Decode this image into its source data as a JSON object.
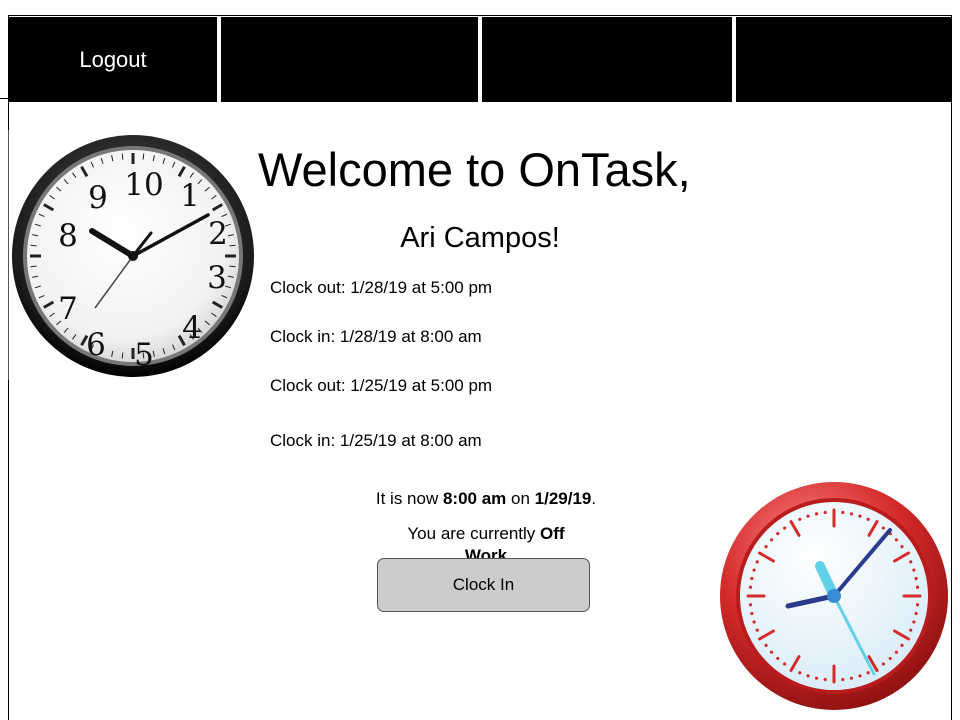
{
  "nav": {
    "logout_label": "Logout",
    "tab2_label": "",
    "tab3_label": "",
    "tab4_label": ""
  },
  "welcome": {
    "title": "Welcome to OnTask,",
    "user": "Ari Campos!"
  },
  "log": [
    "Clock out: 1/28/19 at 5:00 pm",
    "Clock in: 1/28/19 at 8:00 am",
    "Clock out: 1/25/19 at 5:00 pm",
    "Clock in: 1/25/19 at 8:00 am"
  ],
  "now": {
    "prefix": "It is now ",
    "time": "8:00 am",
    "middle": " on ",
    "date": "1/29/19",
    "suffix": "."
  },
  "status": {
    "prefix": "You are currently ",
    "value": "Off Work"
  },
  "clock_button_label": "Clock In",
  "clocks": {
    "left": {
      "icon": "analog-wall-clock-icon"
    },
    "right": {
      "icon": "red-alarm-clock-icon"
    }
  },
  "colors": {
    "nav_bg": "#000000",
    "nav_text": "#ffffff",
    "button_bg": "#cccccc",
    "clock_red": "#d42a2a"
  }
}
